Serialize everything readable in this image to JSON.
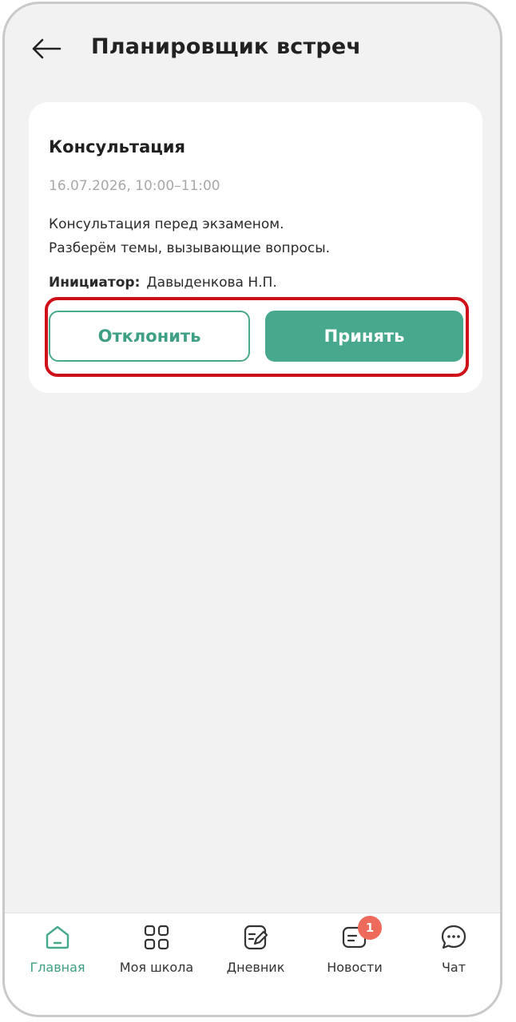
{
  "header": {
    "title": "Планировщик встреч",
    "back_icon": "arrow-left-icon"
  },
  "meeting": {
    "title": "Консультация",
    "datetime": "16.07.2026, 10:00–11:00",
    "description_lines": [
      "Консультация перед экзаменом.",
      "Разберём темы, вызывающие вопросы."
    ],
    "initiator_label": "Инициатор:",
    "initiator_name": "Давыденкова Н.П.",
    "decline_label": "Отклонить",
    "accept_label": "Принять"
  },
  "nav": {
    "items": [
      {
        "label": "Главная",
        "icon": "home-icon",
        "active": true
      },
      {
        "label": "Моя школа",
        "icon": "grid-icon",
        "active": false
      },
      {
        "label": "Дневник",
        "icon": "diary-icon",
        "active": false
      },
      {
        "label": "Новости",
        "icon": "news-icon",
        "active": false,
        "badge": "1"
      },
      {
        "label": "Чат",
        "icon": "chat-icon",
        "active": false
      }
    ]
  },
  "colors": {
    "accent": "#47a88e",
    "highlight": "#d01018",
    "badge": "#ee6a5a",
    "background": "#f2f2f2"
  }
}
